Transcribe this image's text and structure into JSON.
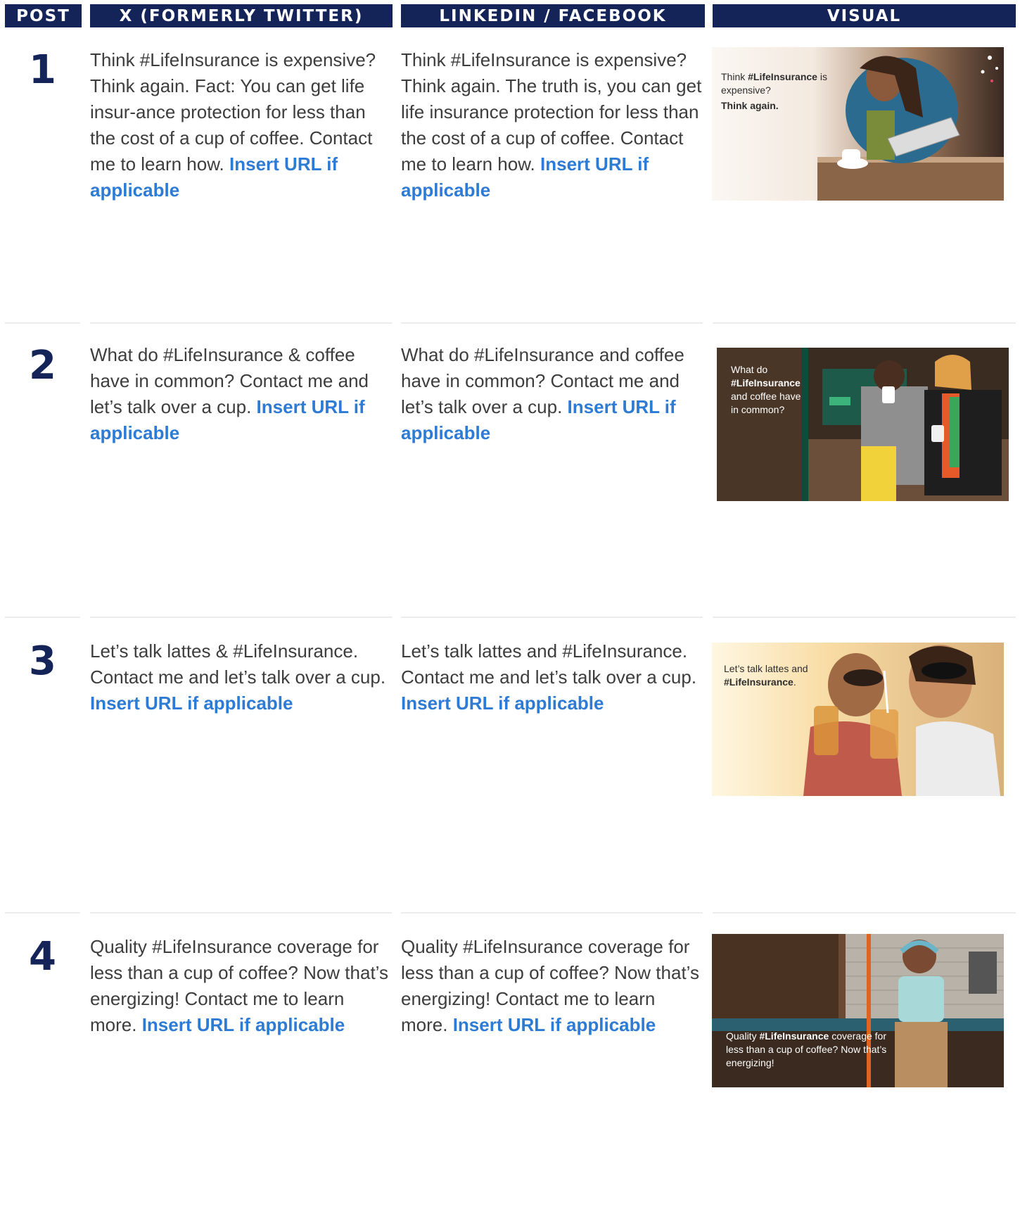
{
  "headers": {
    "post": "POST",
    "x": "X (FORMERLY TWITTER)",
    "linkedin": "LINKEDIN / FACEBOOK",
    "visual": "VISUAL"
  },
  "link_label": "Insert URL if applicable",
  "posts": [
    {
      "number": "1",
      "x_text": "Think #LifeInsurance is expensive? Think again. Fact: You can get life insur-ance protection for less than the cost of a cup of coffee. Contact me to learn how.",
      "linkedin_text": "Think #LifeInsurance is expensive? Think again. The truth is, you can get life insurance protection for less than the cost of a cup of coffee. Contact me to learn how.",
      "visual": {
        "alt": "Woman holding a tablet at a café table with a cup of coffee",
        "caption_pre": "Think",
        "caption_bold": "#LifeInsurance",
        "caption_post": "is expensive?",
        "caption_line2": "Think again."
      }
    },
    {
      "number": "2",
      "x_text": "What do #LifeInsurance & coffee have in common? Contact me and let’s talk over a cup.",
      "linkedin_text": "What do #LifeInsurance and coffee have in common? Contact me and let’s talk over a cup.",
      "visual": {
        "alt": "Two friends laughing outside a coffee shop holding takeaway cups",
        "caption_pre": "What do",
        "caption_bold": "#LifeInsurance",
        "caption_post": "and coffee have in common?"
      }
    },
    {
      "number": "3",
      "x_text": "Let’s talk lattes & #LifeInsurance. Contact me and let’s talk over a cup.",
      "linkedin_text": "Let’s talk lattes and #LifeInsurance. Contact me and let’s talk over a cup.",
      "visual": {
        "alt": "Two smiling friends drinking iced coffee in the sunlight",
        "caption_pre": "Let’s talk lattes and",
        "caption_bold": "#LifeInsurance",
        "caption_post": "."
      }
    },
    {
      "number": "4",
      "x_text": "Quality #LifeInsurance coverage for less than a cup of coffee? Now that’s energizing! Contact me to learn more.",
      "linkedin_text": "Quality #LifeInsurance coverage for less than a cup of coffee? Now that’s energizing! Contact me to learn more.",
      "visual": {
        "alt": "Woman with headphones dancing in a café holding a phone",
        "caption_pre": "Quality",
        "caption_bold": "#LifeInsurance",
        "caption_post": "coverage for less than a cup of coffee? Now that’s energizing!"
      }
    }
  ]
}
